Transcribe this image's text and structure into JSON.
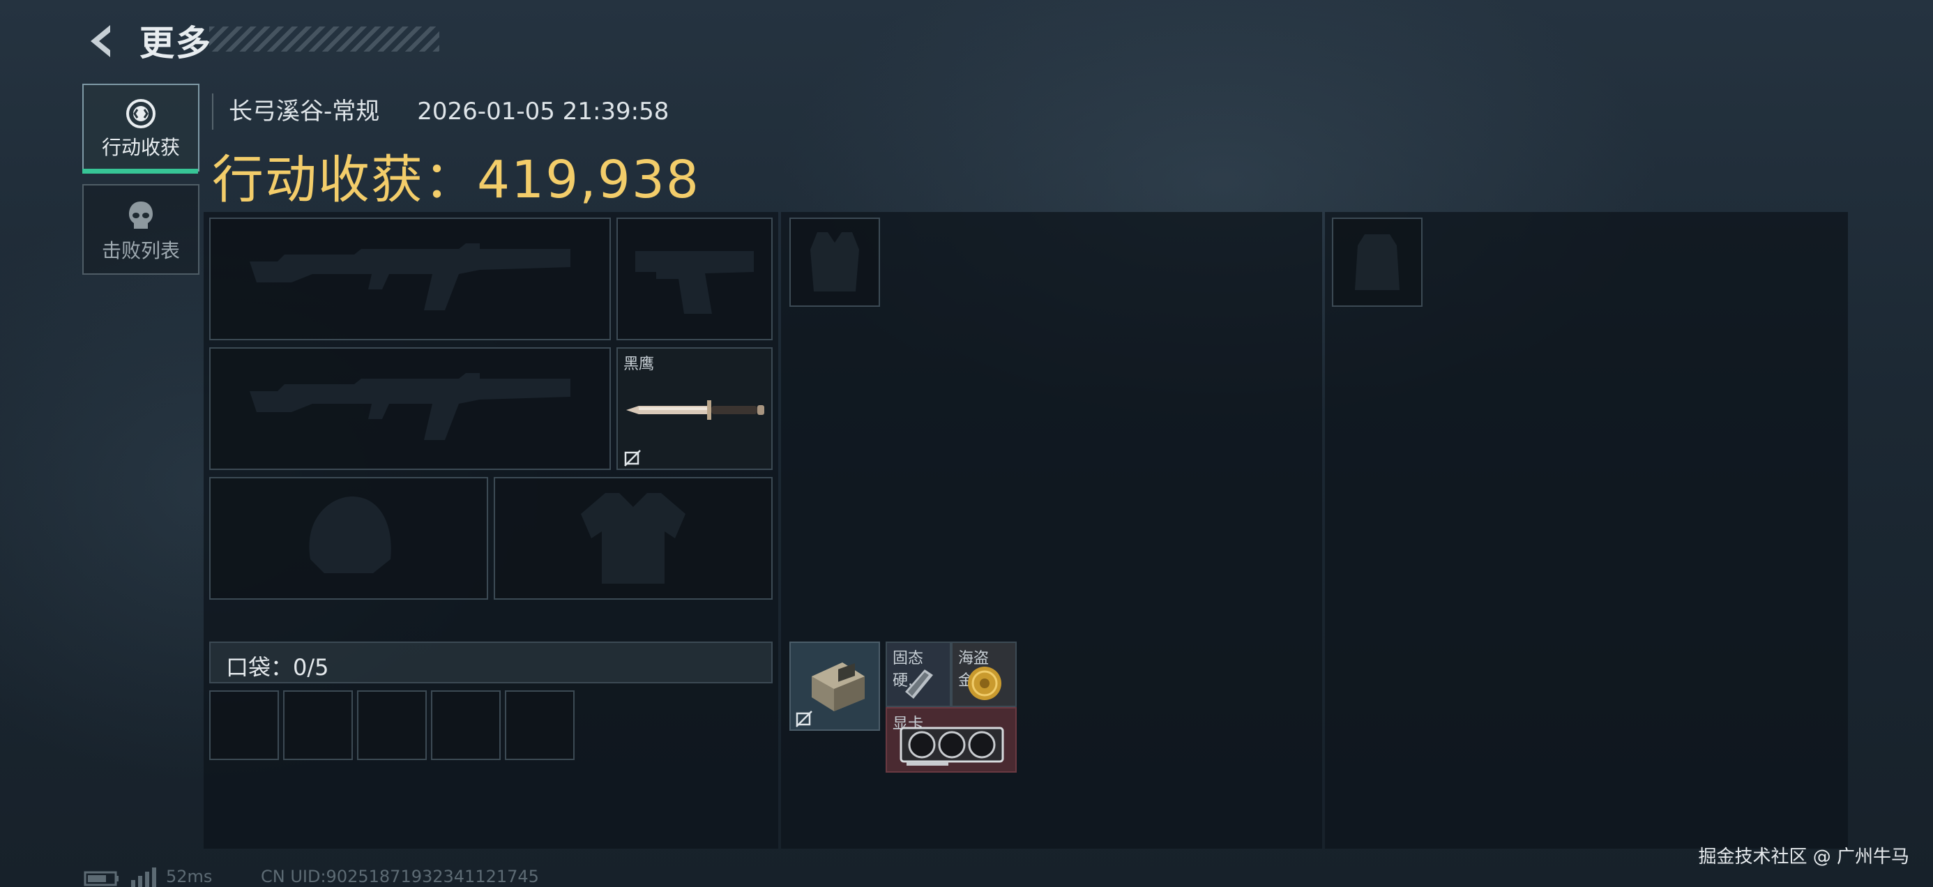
{
  "header": {
    "title": "更多",
    "back_icon": "back-arrow-icon"
  },
  "side_tabs": [
    {
      "label": "行动收获",
      "icon": "target-icon",
      "active": true
    },
    {
      "label": "击败列表",
      "icon": "skull-icon",
      "active": false
    }
  ],
  "match": {
    "map": "长弓溪谷-常规",
    "time": "2026-01-05 21:39:58",
    "loot_label": "行动收获：",
    "loot_value": "419,938"
  },
  "equipment": {
    "melee_name": "黑鹰"
  },
  "pocket": {
    "label": "口袋：0/5",
    "slots": 5
  },
  "backpack_items": [
    {
      "label": "固态硬...",
      "icon": "ssd-icon"
    },
    {
      "label": "海盗金...",
      "icon": "gold-coin-icon"
    },
    {
      "label": "显卡",
      "icon": "graphics-card-icon"
    }
  ],
  "status": {
    "ping": "52ms",
    "uid": "CN UID:9025187193234112174​5"
  },
  "watermark": "掘金技术社区 @ 广州牛马",
  "colors": {
    "accent_green": "#37c596",
    "loot_gold": "#f3cd6a",
    "rare_red": "#5a2a30"
  }
}
